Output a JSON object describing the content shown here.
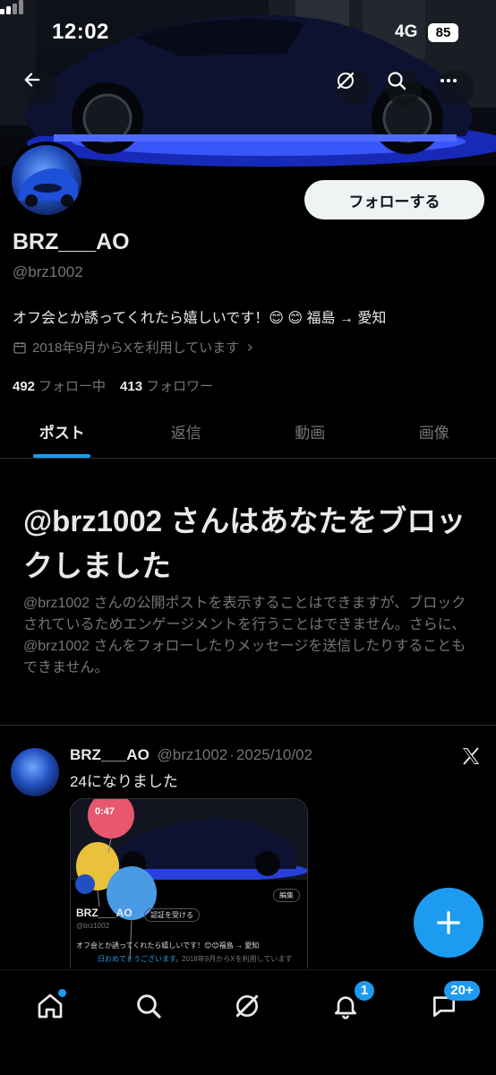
{
  "status_bar": {
    "time": "12:02",
    "network": "4G",
    "battery": "85"
  },
  "header": {
    "back_icon": "arrow-left-icon",
    "grok_icon": "grok-icon",
    "search_icon": "search-icon",
    "more_icon": "more-icon"
  },
  "profile": {
    "display_name": "BRZ___AO",
    "handle": "@brz1002",
    "bio": "オフ会とか誘ってくれたら嬉しいです！😊 😊 福島 → 愛知",
    "joined": "2018年9月からXを利用しています",
    "following_count": "492",
    "following_label": "フォロー中",
    "followers_count": "413",
    "followers_label": "フォロワー",
    "follow_button": "フォローする"
  },
  "tabs": [
    {
      "label": "ポスト",
      "active": true
    },
    {
      "label": "返信",
      "active": false
    },
    {
      "label": "動画",
      "active": false
    },
    {
      "label": "画像",
      "active": false
    }
  ],
  "blocked": {
    "title": "@brz1002 さんはあなたをブロックしました",
    "body": "@brz1002 さんの公開ポストを表示することはできますが、ブロックされているためエンゲージメントを行うことはできません。さらに、@brz1002 さんをフォローしたりメッセージを送信したりすることもできません。"
  },
  "post": {
    "name": "BRZ___AO",
    "handle": "@brz1002",
    "separator": "·",
    "date": "2025/10/02",
    "text": "24になりました",
    "media": {
      "time": "0:47",
      "edit_label": "編集",
      "name": "BRZ___AO",
      "verify_label": "認証を受ける",
      "handle": "@brz1002",
      "bio": "オフ会とか誘ってくれたら嬉しいです！😊😊福島 → 愛知",
      "birthday": "日おめでとうございます。",
      "joined": "2018年9月からXを利用しています"
    }
  },
  "bottom_nav": {
    "notifications_badge": "1",
    "messages_badge": "20+"
  },
  "colors": {
    "accent": "#1d9bf0",
    "background": "#000000",
    "text": "#e7e9ea",
    "muted": "#71767b"
  }
}
